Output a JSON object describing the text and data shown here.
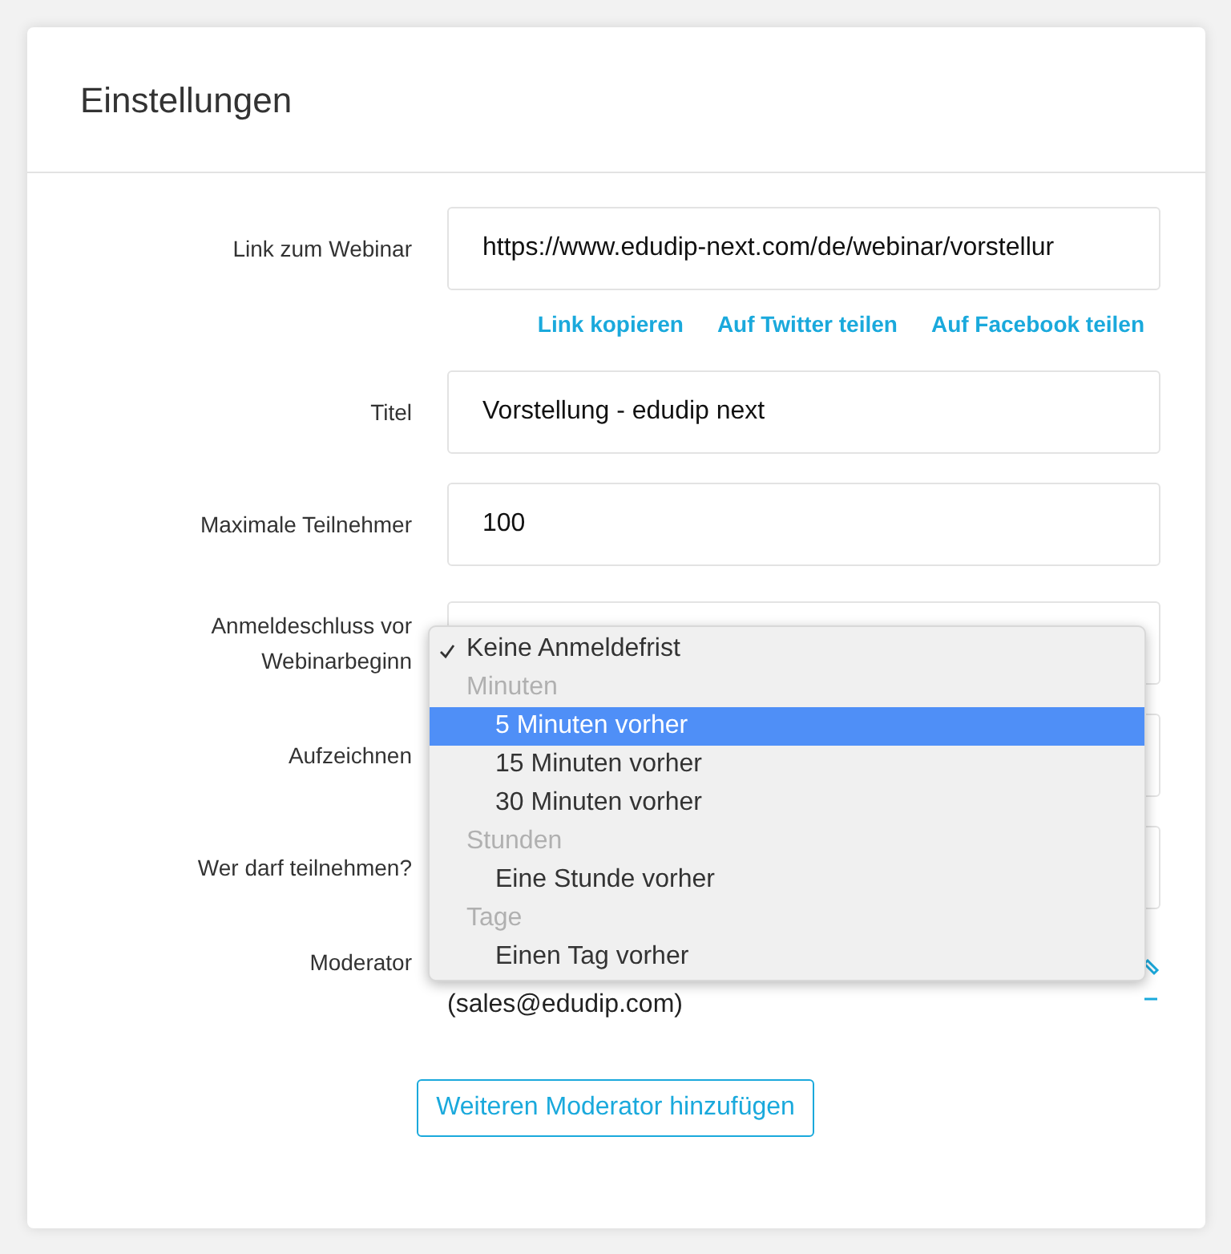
{
  "header": {
    "title": "Einstellungen"
  },
  "rows": [
    {
      "kind": "input",
      "label": "Link zum Webinar",
      "value": "https://www.edudip-next.com/de/webinar/vorstellur"
    },
    {
      "kind": "links",
      "links": [
        "Link kopieren",
        "Auf Twitter teilen",
        "Auf Facebook teilen"
      ]
    },
    {
      "kind": "input",
      "label": "Titel",
      "value": "Vorstellung - edudip next"
    },
    {
      "kind": "input",
      "label": "Maximale Teilnehmer",
      "value": "100"
    },
    {
      "kind": "select",
      "label": "Anmeldeschluss vor Webinarbeginn"
    },
    {
      "kind": "select",
      "label": "Aufzeichnen"
    },
    {
      "kind": "select",
      "label": "Wer darf teilnehmen?"
    },
    {
      "kind": "moderator",
      "label": "Moderator",
      "email": "(sales@edudip.com)"
    }
  ],
  "add_button": "Weiteren Moderator hinzufügen",
  "dropdown": {
    "options": [
      {
        "kind": "option",
        "label": "Keine Anmeldefrist",
        "selected": true,
        "highlighted": false,
        "indented": false
      },
      {
        "kind": "group",
        "label": "Minuten"
      },
      {
        "kind": "option",
        "label": "5 Minuten vorher",
        "selected": false,
        "highlighted": true,
        "indented": true
      },
      {
        "kind": "option",
        "label": "15 Minuten vorher",
        "selected": false,
        "highlighted": false,
        "indented": true
      },
      {
        "kind": "option",
        "label": "30 Minuten vorher",
        "selected": false,
        "highlighted": false,
        "indented": true
      },
      {
        "kind": "group",
        "label": "Stunden"
      },
      {
        "kind": "option",
        "label": "Eine Stunde vorher",
        "selected": false,
        "highlighted": false,
        "indented": true
      },
      {
        "kind": "group",
        "label": "Tage"
      },
      {
        "kind": "option",
        "label": "Einen Tag vorher",
        "selected": false,
        "highlighted": false,
        "indented": true
      }
    ]
  }
}
